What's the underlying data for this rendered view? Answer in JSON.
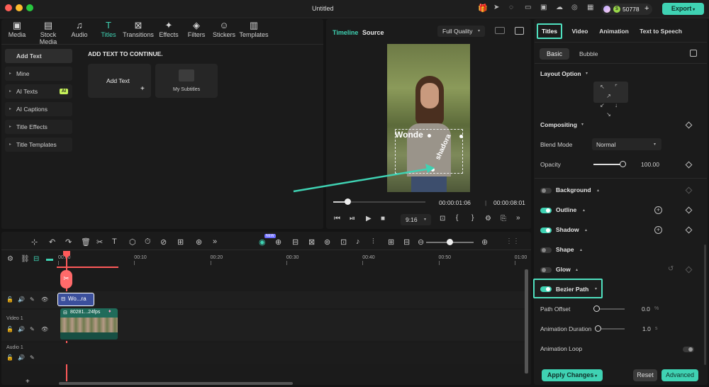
{
  "window": {
    "title": "Untitled"
  },
  "header": {
    "credits": "50778",
    "export_label": "Export",
    "add_symbol": "+"
  },
  "toolbar": {
    "items": [
      {
        "label": "Media",
        "icon": "media-icon"
      },
      {
        "label": "Stock Media",
        "icon": "stock-media-icon"
      },
      {
        "label": "Audio",
        "icon": "audio-icon"
      },
      {
        "label": "Titles",
        "icon": "titles-icon"
      },
      {
        "label": "Transitions",
        "icon": "transitions-icon"
      },
      {
        "label": "Effects",
        "icon": "effects-icon"
      },
      {
        "label": "Filters",
        "icon": "filters-icon"
      },
      {
        "label": "Stickers",
        "icon": "stickers-icon"
      },
      {
        "label": "Templates",
        "icon": "templates-icon"
      }
    ]
  },
  "sidebar": {
    "items": [
      {
        "label": "Add Text"
      },
      {
        "label": "Mine"
      },
      {
        "label": "AI Texts",
        "badge": "AI"
      },
      {
        "label": "AI Captions"
      },
      {
        "label": "Title Effects"
      },
      {
        "label": "Title Templates"
      }
    ]
  },
  "library": {
    "heading": "ADD TEXT TO CONTINUE.",
    "add_text_card": "Add Text",
    "subtitles_card": "My Subtitles"
  },
  "player": {
    "tab_timeline": "Timeline",
    "tab_source": "Source",
    "quality": "Full Quality",
    "overlay_text": "Wonde",
    "overlay_curve": "shadora",
    "current_time": "00:00:01:06",
    "total_time": "00:00:08:01",
    "ratio": "9:16",
    "progress_fraction": 0.15
  },
  "properties": {
    "tabs": [
      "Titles",
      "Video",
      "Animation",
      "Text to Speech"
    ],
    "subtabs": [
      "Basic",
      "Bubble"
    ],
    "layout_option": "Layout Option",
    "compositing": "Compositing",
    "blend_mode_label": "Blend Mode",
    "blend_mode_value": "Normal",
    "opacity_label": "Opacity",
    "opacity_value": "100.00",
    "opacity_fraction": 1.0,
    "background": "Background",
    "outline": "Outline",
    "shadow": "Shadow",
    "shape": "Shape",
    "glow": "Glow",
    "bezier_path": "Bezier Path",
    "path_offset_label": "Path Offset",
    "path_offset_value": "0.0",
    "path_offset_unit": "%",
    "anim_duration_label": "Animation Duration",
    "anim_duration_value": "1.0",
    "anim_duration_unit": "s",
    "anim_loop_label": "Animation Loop",
    "apply_changes": "Apply Changes",
    "reset": "Reset",
    "advanced": "Advanced"
  },
  "timeline": {
    "ruler": [
      "00:00",
      "00:10",
      "00:20",
      "00:30",
      "00:40",
      "00:50",
      "01:00"
    ],
    "title_clip": "Wo...ra",
    "video_clip": "80281...24fps",
    "video_track": "Video 1",
    "audio_track": "Audio 1",
    "ai_badge": "NEW"
  },
  "colors": {
    "accent": "#3fd2b3",
    "highlight_box": "#4fe0bf",
    "title_clip": "#3b4f9c",
    "video_clip": "#1f6b5a",
    "playhead": "#ff5a5a"
  }
}
